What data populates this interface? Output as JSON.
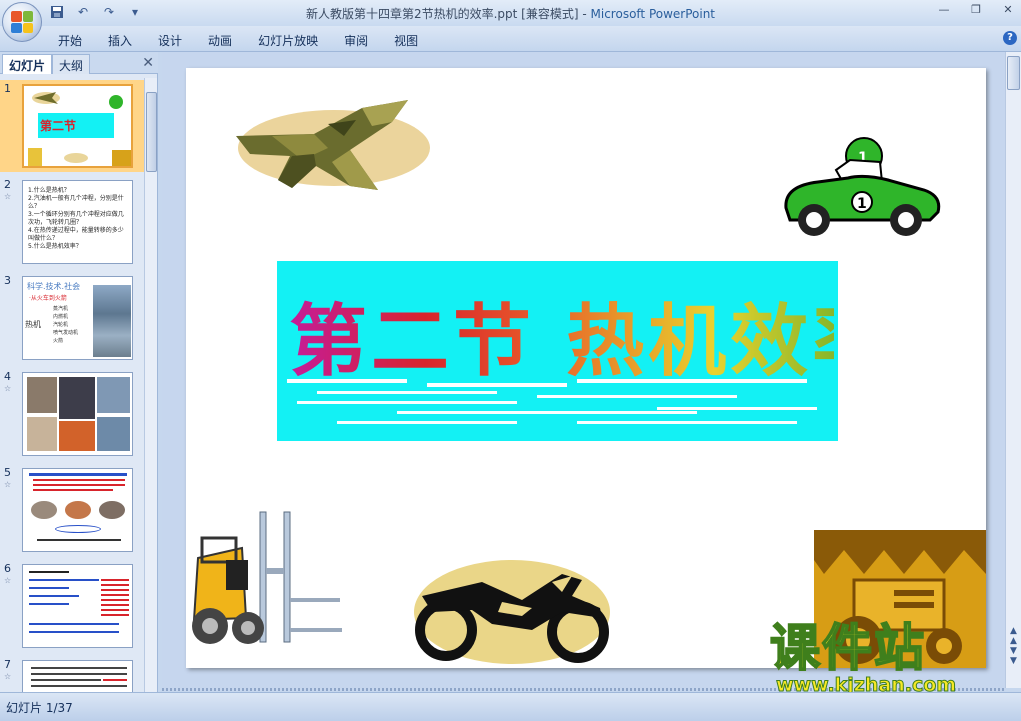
{
  "window": {
    "title": "新人教版第十四章第2节热机的效率.ppt [兼容模式]",
    "app_name": "Microsoft PowerPoint",
    "title_separator": " - "
  },
  "ribbon": {
    "tabs": [
      "开始",
      "插入",
      "设计",
      "动画",
      "幻灯片放映",
      "审阅",
      "视图"
    ]
  },
  "left_panel": {
    "tabs": [
      "幻灯片",
      "大纲"
    ],
    "close_glyph": "✕",
    "slide_numbers": [
      "1",
      "2",
      "3",
      "4",
      "5",
      "6",
      "7"
    ],
    "slide2_lines": [
      "1.什么是热机？",
      "2.汽油机一般有几个冲程，分别是什么？",
      "3.一个循环分别有几个冲程对应做几次功，飞轮转几圈？",
      "4.在热传递过程中，能量转移的多少叫做什么？",
      "5.什么是热机效率？"
    ],
    "slide3_heading": "科学.技术.社会",
    "slide3_sub": "·从火车到火箭",
    "slide3_side": "热机",
    "slide3_items": [
      "蒸汽机",
      "内燃机",
      "汽轮机",
      "喷气发动机",
      "火箭"
    ]
  },
  "slide": {
    "title": "第二节 热机效率"
  },
  "watermark": {
    "text": "课件站",
    "url": "www.kjzhan.com"
  },
  "statusbar": {
    "slide_info": "幻灯片 1/37"
  },
  "colors": {
    "banner_bg": "#13f1f4",
    "selected_thumb": "#ffd588"
  }
}
